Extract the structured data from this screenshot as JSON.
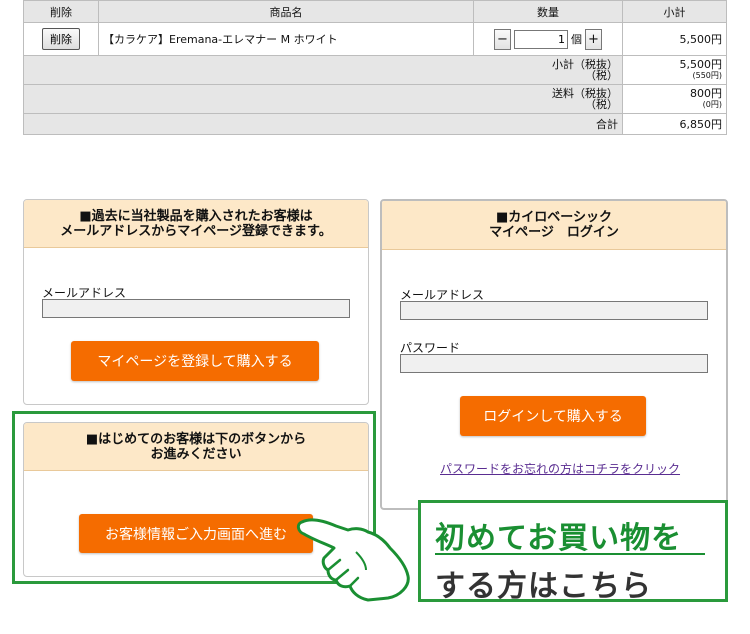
{
  "cart": {
    "headers": {
      "delete": "削除",
      "product": "商品名",
      "quantity": "数量",
      "subtotal": "小計"
    },
    "item": {
      "delete_label": "削除",
      "name": "【カラケア】Eremana-エレマナー M ホワイト",
      "qty_minus": "−",
      "qty_value": "1",
      "qty_unit": "個",
      "qty_plus": "+",
      "price": "5,500円"
    },
    "summary": {
      "subtotal_label_1": "小計（税抜）",
      "subtotal_label_2": "（税）",
      "subtotal_value_1": "5,500円",
      "subtotal_value_2": "(550円)",
      "shipping_label_1": "送料（税抜）",
      "shipping_label_2": "（税）",
      "shipping_value_1": "800円",
      "shipping_value_2": "(0円)",
      "total_label": "合計",
      "total_value": "6,850円"
    }
  },
  "register_panel": {
    "title_line1": "■過去に当社製品を購入されたお客様は",
    "title_line2": "メールアドレスからマイページ登録できます。",
    "email_label": "メールアドレス",
    "button": "マイページを登録して購入する"
  },
  "login_panel": {
    "title_line1": "■カイロベーシック",
    "title_line2": "マイページ　ログイン",
    "email_label": "メールアドレス",
    "password_label": "パスワード",
    "button": "ログインして購入する",
    "forgot_link": "パスワードをお忘れの方はコチラをクリック"
  },
  "first_time_panel": {
    "title_line1": "■はじめてのお客様は下のボタンから",
    "title_line2": "お進みください",
    "button": "お客様情報ご入力画面へ進む"
  },
  "callout": {
    "line1": "初めてお買い物を",
    "line2": "する方はこちら"
  },
  "colors": {
    "accent": "#f56c00",
    "highlight": "#2a9a3c",
    "panel_header": "#fde8c8"
  }
}
